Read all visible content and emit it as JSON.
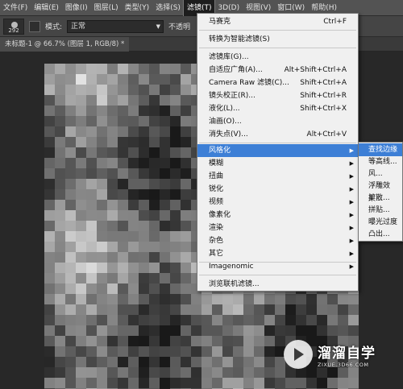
{
  "menubar": {
    "items": [
      {
        "label": "文件(F)"
      },
      {
        "label": "编辑(E)"
      },
      {
        "label": "图像(I)"
      },
      {
        "label": "图层(L)"
      },
      {
        "label": "类型(Y)"
      },
      {
        "label": "选择(S)"
      },
      {
        "label": "滤镜(T)"
      },
      {
        "label": "3D(D)"
      },
      {
        "label": "视图(V)"
      },
      {
        "label": "窗口(W)"
      },
      {
        "label": "帮助(H)"
      }
    ],
    "active_index": 6
  },
  "options_bar": {
    "brush_size": "292",
    "mode_label": "模式:",
    "mode_value": "正常",
    "opacity_label": "不透明"
  },
  "document_tab": {
    "title": "未标题-1 @ 66.7% (图层 1, RGB/8) *"
  },
  "filter_menu": {
    "items": [
      {
        "label": "马赛克",
        "shortcut": "Ctrl+F"
      },
      {
        "label": "转换为智能滤镜(S)",
        "shortcut": ""
      },
      {
        "label": "滤镜库(G)...",
        "shortcut": ""
      },
      {
        "label": "自适应广角(A)...",
        "shortcut": "Alt+Shift+Ctrl+A"
      },
      {
        "label": "Camera Raw 滤镜(C)...",
        "shortcut": "Shift+Ctrl+A"
      },
      {
        "label": "镜头校正(R)...",
        "shortcut": "Shift+Ctrl+R"
      },
      {
        "label": "液化(L)...",
        "shortcut": "Shift+Ctrl+X"
      },
      {
        "label": "油画(O)...",
        "shortcut": ""
      },
      {
        "label": "消失点(V)...",
        "shortcut": "Alt+Ctrl+V"
      },
      {
        "label": "风格化",
        "shortcut": ""
      },
      {
        "label": "模糊",
        "shortcut": ""
      },
      {
        "label": "扭曲",
        "shortcut": ""
      },
      {
        "label": "锐化",
        "shortcut": ""
      },
      {
        "label": "视频",
        "shortcut": ""
      },
      {
        "label": "像素化",
        "shortcut": ""
      },
      {
        "label": "渲染",
        "shortcut": ""
      },
      {
        "label": "杂色",
        "shortcut": ""
      },
      {
        "label": "其它",
        "shortcut": ""
      },
      {
        "label": "Imagenomic",
        "shortcut": ""
      },
      {
        "label": "浏览联机滤镜...",
        "shortcut": ""
      }
    ]
  },
  "stylize_submenu": {
    "items": [
      {
        "label": "查找边缘"
      },
      {
        "label": "等高线..."
      },
      {
        "label": "风..."
      },
      {
        "label": "浮雕效果..."
      },
      {
        "label": "扩散..."
      },
      {
        "label": "拼贴..."
      },
      {
        "label": "曝光过度"
      },
      {
        "label": "凸出..."
      }
    ]
  },
  "watermark": {
    "title": "溜溜自学",
    "subtitle": "ZIXUE.3D66.COM"
  }
}
